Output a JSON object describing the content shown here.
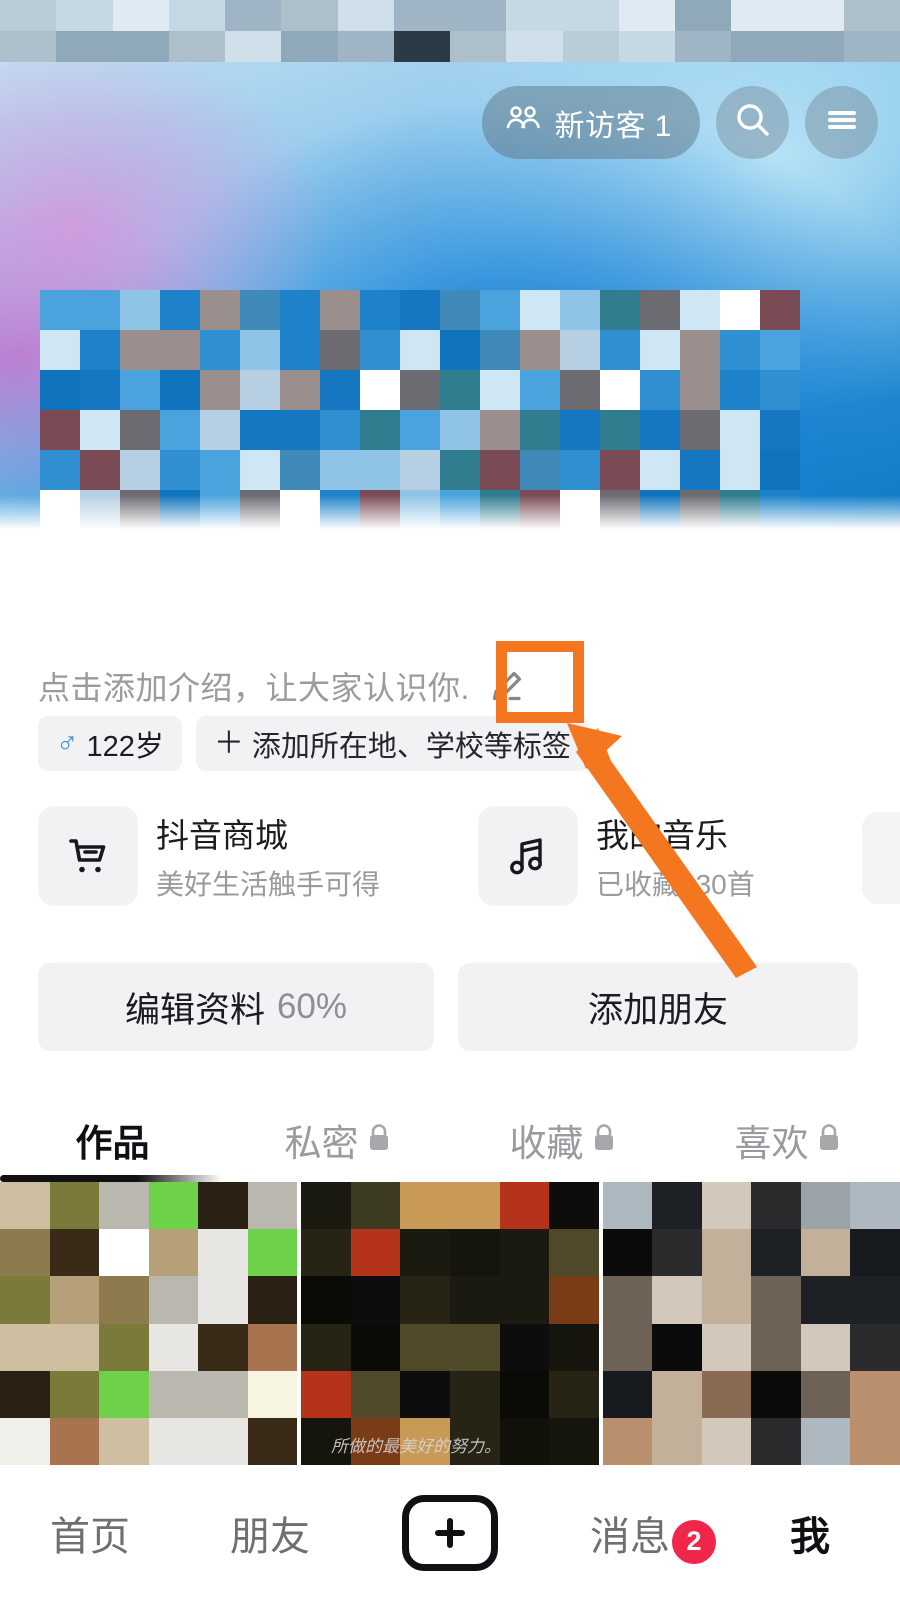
{
  "topnav": {
    "visitor_label": "新访客 1",
    "visitor_icon": "people-icon",
    "search_icon": "search-icon",
    "menu_icon": "hamburger-menu-icon"
  },
  "profile": {
    "intro_placeholder": "点击添加介绍，让大家认识你.",
    "edit_intro_icon": "pencil-edit-icon",
    "tags": [
      {
        "name": "age-gender-tag",
        "icon": "male-gender-icon",
        "label": "122岁"
      },
      {
        "name": "add-tag-tag",
        "icon": "plus-icon",
        "label": "添加所在地、学校等标签"
      }
    ]
  },
  "shortcut_cards": [
    {
      "name": "douyin-mall-card",
      "icon": "shopping-cart-icon",
      "title": "抖音商城",
      "subtitle": "美好生活触手可得"
    },
    {
      "name": "my-music-card",
      "icon": "music-note-icon",
      "title": "我的音乐",
      "subtitle": "已收藏330首"
    }
  ],
  "actions": {
    "edit_profile_label": "编辑资料",
    "edit_profile_percent": "60%",
    "add_friend_label": "添加朋友"
  },
  "tabs": [
    {
      "label": "作品",
      "locked": false,
      "active": true
    },
    {
      "label": "私密",
      "locked": true,
      "active": false
    },
    {
      "label": "收藏",
      "locked": true,
      "active": false
    },
    {
      "label": "喜欢",
      "locked": true,
      "active": false
    }
  ],
  "grid": {
    "thumbnails": [
      {
        "name": "video-thumbnail-1",
        "caption": ""
      },
      {
        "name": "video-thumbnail-2",
        "caption": "所做的最美好的努力。"
      },
      {
        "name": "video-thumbnail-3",
        "caption": ""
      }
    ]
  },
  "bottomnav": [
    {
      "label": "首页",
      "active": false,
      "badge": ""
    },
    {
      "label": "朋友",
      "active": false,
      "badge": ""
    },
    {
      "label": "",
      "active": false,
      "badge": "",
      "icon": "plus-create-icon"
    },
    {
      "label": "消息",
      "active": false,
      "badge": "2"
    },
    {
      "label": "我",
      "active": true,
      "badge": ""
    }
  ],
  "annotation": {
    "highlight_color": "#f4761f",
    "arrow_color": "#f4761f",
    "target": "pencil-edit-icon"
  },
  "colors": {
    "accent_orange": "#f4761f",
    "badge_red": "#f0264b",
    "gender_blue": "#3d8fe0",
    "muted_text": "#9a9a9f",
    "chip_bg": "#f2f2f4",
    "banner_blue": "#0d79c6"
  }
}
